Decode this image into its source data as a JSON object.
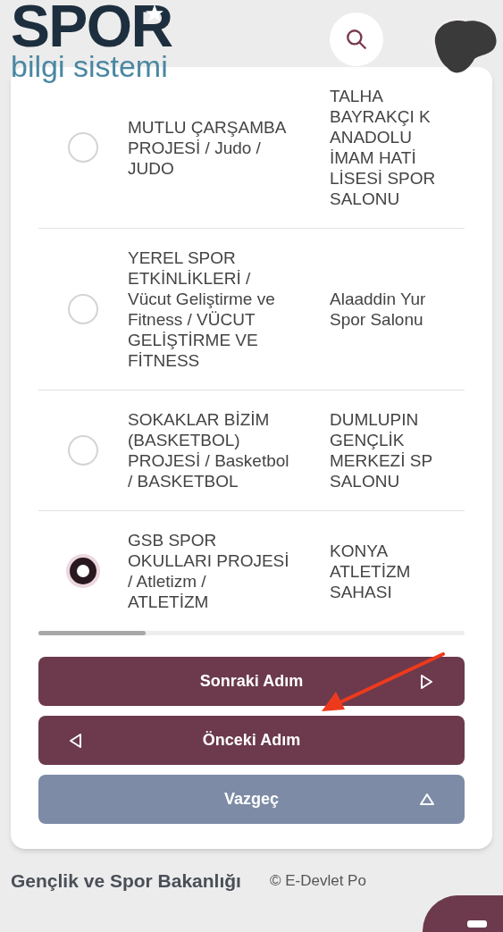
{
  "header": {
    "logo_title": "SPOR",
    "logo_subtitle": "bilgi sistemi"
  },
  "rows": [
    {
      "name": "MUTLU ÇARŞAMBA PROJESİ / Judo / JUDO",
      "venue_lines": [
        "TALHA",
        "BAYRAKÇI K",
        "ANADOLU",
        "İMAM HATİ",
        "LİSESİ SPOR",
        "SALONU"
      ],
      "selected": false
    },
    {
      "name": "YEREL SPOR ETKİNLİKLERİ / Vücut Geliştirme ve Fitness / VÜCUT GELİŞTİRME VE FİTNESS",
      "venue_lines": [
        "Alaaddin Yur",
        "Spor Salonu"
      ],
      "selected": false
    },
    {
      "name": "SOKAKLAR BİZİM (BASKETBOL) PROJESİ / Basketbol / BASKETBOL",
      "venue_lines": [
        "DUMLUPIN",
        "GENÇLİK",
        "MERKEZİ SP",
        "SALONU"
      ],
      "selected": false
    },
    {
      "name": "GSB SPOR OKULLARI PROJESİ / Atletizm / ATLETİZM",
      "venue_lines": [
        "KONYA",
        "ATLETİZM",
        "SAHASI"
      ],
      "selected": true
    }
  ],
  "buttons": [
    {
      "label": "Sonraki Adım",
      "kind": "next"
    },
    {
      "label": "Önceki Adım",
      "kind": "previous"
    },
    {
      "label": "Vazgeç",
      "kind": "cancel"
    }
  ],
  "footer": {
    "ministry": "Gençlik ve Spor Bakanlığı",
    "copyright": "© E-Devlet Po"
  }
}
